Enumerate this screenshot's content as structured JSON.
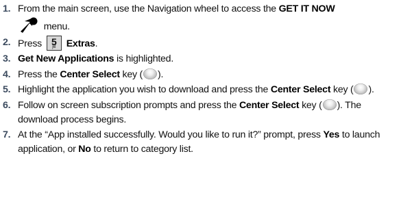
{
  "steps": [
    {
      "num": "1.",
      "a": "From the main screen, use the Navigation wheel to access the ",
      "b": "GET IT NOW",
      "c": " menu.",
      "icon": "get-it-now-icon"
    },
    {
      "num": "2.",
      "a": "Press ",
      "key_digit": "5",
      "key_letters": "jkl",
      "b": "Extras",
      "c": ".",
      "icon": "key-5-icon"
    },
    {
      "num": "3.",
      "b": "Get New Applications",
      "c": " is highlighted."
    },
    {
      "num": "4.",
      "a": "Press the ",
      "b": "Center Select",
      "c": " key (",
      "d": ").",
      "icon": "center-select-key-icon"
    },
    {
      "num": "5.",
      "a": "Highlight the application you wish to download and press the ",
      "b": "Center Select",
      "c": " key (",
      "d": ").",
      "icon": "center-select-key-icon"
    },
    {
      "num": "6.",
      "a": "Follow on screen subscription prompts and press the ",
      "b": "Center Select",
      "c": " key (",
      "d": "). The download process begins.",
      "icon": "center-select-key-icon"
    },
    {
      "num": "7.",
      "a": "At the “App installed successfully. Would you like to run it?” prompt, press ",
      "b": "Yes",
      "c": " to launch application, or ",
      "d": "No",
      "e": " to return to category list."
    }
  ]
}
